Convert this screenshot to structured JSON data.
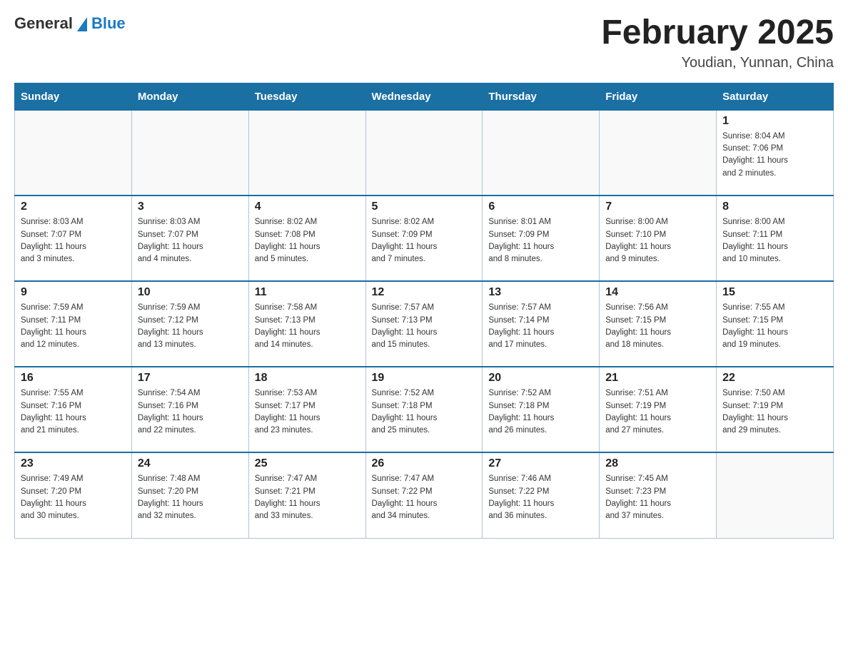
{
  "header": {
    "logo_general": "General",
    "logo_blue": "Blue",
    "month_title": "February 2025",
    "location": "Youdian, Yunnan, China"
  },
  "weekdays": [
    "Sunday",
    "Monday",
    "Tuesday",
    "Wednesday",
    "Thursday",
    "Friday",
    "Saturday"
  ],
  "weeks": [
    [
      {
        "day": "",
        "info": ""
      },
      {
        "day": "",
        "info": ""
      },
      {
        "day": "",
        "info": ""
      },
      {
        "day": "",
        "info": ""
      },
      {
        "day": "",
        "info": ""
      },
      {
        "day": "",
        "info": ""
      },
      {
        "day": "1",
        "info": "Sunrise: 8:04 AM\nSunset: 7:06 PM\nDaylight: 11 hours\nand 2 minutes."
      }
    ],
    [
      {
        "day": "2",
        "info": "Sunrise: 8:03 AM\nSunset: 7:07 PM\nDaylight: 11 hours\nand 3 minutes."
      },
      {
        "day": "3",
        "info": "Sunrise: 8:03 AM\nSunset: 7:07 PM\nDaylight: 11 hours\nand 4 minutes."
      },
      {
        "day": "4",
        "info": "Sunrise: 8:02 AM\nSunset: 7:08 PM\nDaylight: 11 hours\nand 5 minutes."
      },
      {
        "day": "5",
        "info": "Sunrise: 8:02 AM\nSunset: 7:09 PM\nDaylight: 11 hours\nand 7 minutes."
      },
      {
        "day": "6",
        "info": "Sunrise: 8:01 AM\nSunset: 7:09 PM\nDaylight: 11 hours\nand 8 minutes."
      },
      {
        "day": "7",
        "info": "Sunrise: 8:00 AM\nSunset: 7:10 PM\nDaylight: 11 hours\nand 9 minutes."
      },
      {
        "day": "8",
        "info": "Sunrise: 8:00 AM\nSunset: 7:11 PM\nDaylight: 11 hours\nand 10 minutes."
      }
    ],
    [
      {
        "day": "9",
        "info": "Sunrise: 7:59 AM\nSunset: 7:11 PM\nDaylight: 11 hours\nand 12 minutes."
      },
      {
        "day": "10",
        "info": "Sunrise: 7:59 AM\nSunset: 7:12 PM\nDaylight: 11 hours\nand 13 minutes."
      },
      {
        "day": "11",
        "info": "Sunrise: 7:58 AM\nSunset: 7:13 PM\nDaylight: 11 hours\nand 14 minutes."
      },
      {
        "day": "12",
        "info": "Sunrise: 7:57 AM\nSunset: 7:13 PM\nDaylight: 11 hours\nand 15 minutes."
      },
      {
        "day": "13",
        "info": "Sunrise: 7:57 AM\nSunset: 7:14 PM\nDaylight: 11 hours\nand 17 minutes."
      },
      {
        "day": "14",
        "info": "Sunrise: 7:56 AM\nSunset: 7:15 PM\nDaylight: 11 hours\nand 18 minutes."
      },
      {
        "day": "15",
        "info": "Sunrise: 7:55 AM\nSunset: 7:15 PM\nDaylight: 11 hours\nand 19 minutes."
      }
    ],
    [
      {
        "day": "16",
        "info": "Sunrise: 7:55 AM\nSunset: 7:16 PM\nDaylight: 11 hours\nand 21 minutes."
      },
      {
        "day": "17",
        "info": "Sunrise: 7:54 AM\nSunset: 7:16 PM\nDaylight: 11 hours\nand 22 minutes."
      },
      {
        "day": "18",
        "info": "Sunrise: 7:53 AM\nSunset: 7:17 PM\nDaylight: 11 hours\nand 23 minutes."
      },
      {
        "day": "19",
        "info": "Sunrise: 7:52 AM\nSunset: 7:18 PM\nDaylight: 11 hours\nand 25 minutes."
      },
      {
        "day": "20",
        "info": "Sunrise: 7:52 AM\nSunset: 7:18 PM\nDaylight: 11 hours\nand 26 minutes."
      },
      {
        "day": "21",
        "info": "Sunrise: 7:51 AM\nSunset: 7:19 PM\nDaylight: 11 hours\nand 27 minutes."
      },
      {
        "day": "22",
        "info": "Sunrise: 7:50 AM\nSunset: 7:19 PM\nDaylight: 11 hours\nand 29 minutes."
      }
    ],
    [
      {
        "day": "23",
        "info": "Sunrise: 7:49 AM\nSunset: 7:20 PM\nDaylight: 11 hours\nand 30 minutes."
      },
      {
        "day": "24",
        "info": "Sunrise: 7:48 AM\nSunset: 7:20 PM\nDaylight: 11 hours\nand 32 minutes."
      },
      {
        "day": "25",
        "info": "Sunrise: 7:47 AM\nSunset: 7:21 PM\nDaylight: 11 hours\nand 33 minutes."
      },
      {
        "day": "26",
        "info": "Sunrise: 7:47 AM\nSunset: 7:22 PM\nDaylight: 11 hours\nand 34 minutes."
      },
      {
        "day": "27",
        "info": "Sunrise: 7:46 AM\nSunset: 7:22 PM\nDaylight: 11 hours\nand 36 minutes."
      },
      {
        "day": "28",
        "info": "Sunrise: 7:45 AM\nSunset: 7:23 PM\nDaylight: 11 hours\nand 37 minutes."
      },
      {
        "day": "",
        "info": ""
      }
    ]
  ]
}
